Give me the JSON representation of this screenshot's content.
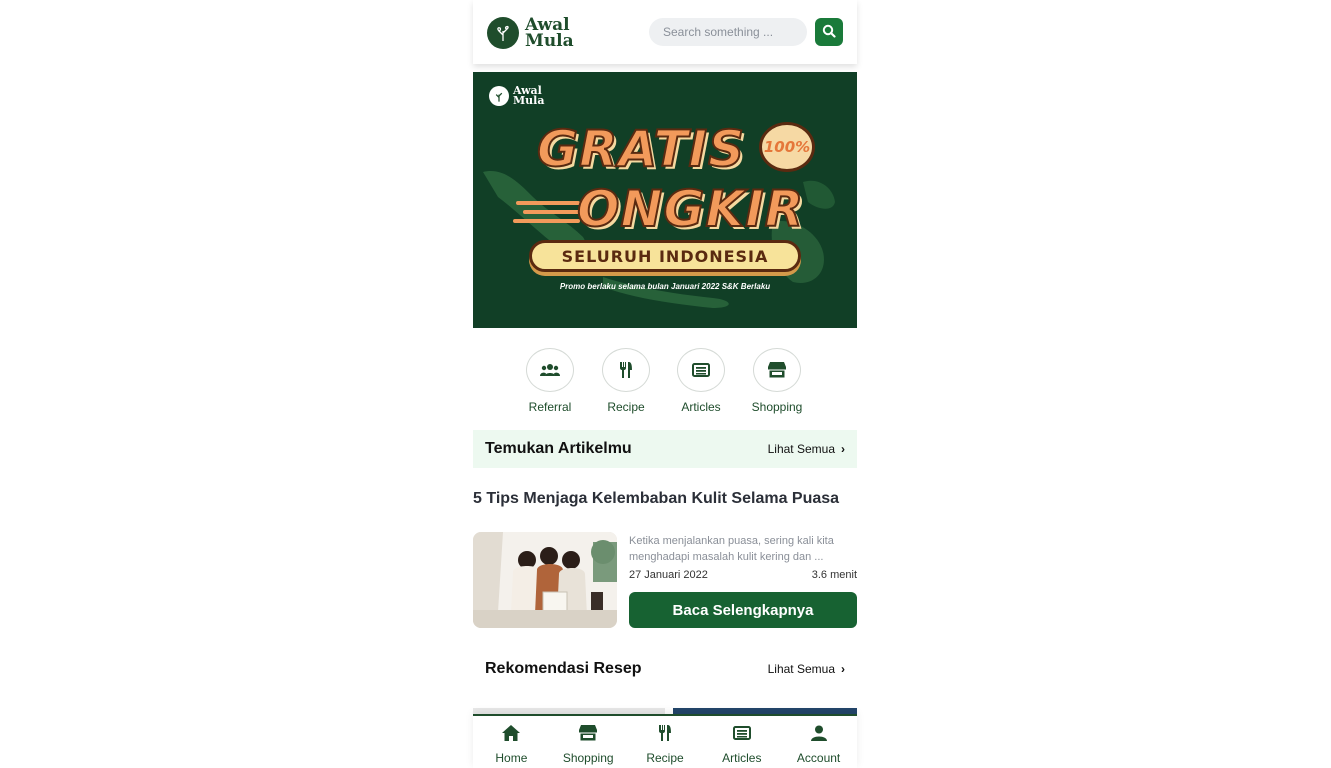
{
  "header": {
    "logo_line1": "Awal",
    "logo_line2": "Mula",
    "search_placeholder": "Search something ..."
  },
  "banner": {
    "logo_line1": "Awal",
    "logo_line2": "Mula",
    "headline1": "GRATIS",
    "badge": "100%",
    "headline2": "ONGKIR",
    "pill": "SELURUH INDONESIA",
    "promo": "Promo berlaku selama bulan Januari 2022 S&K Berlaku"
  },
  "quick_menu": [
    {
      "label": "Referral",
      "icon": "users-icon"
    },
    {
      "label": "Recipe",
      "icon": "utensils-icon"
    },
    {
      "label": "Articles",
      "icon": "newspaper-icon"
    },
    {
      "label": "Shopping",
      "icon": "store-icon"
    }
  ],
  "articles_section": {
    "title": "Temukan Artikelmu",
    "see_all": "Lihat Semua"
  },
  "article": {
    "title": "5 Tips Menjaga Kelembaban Kulit Selama Puasa",
    "excerpt": "Ketika menjalankan puasa, sering kali kita menghadapi masalah kulit kering dan ...",
    "date": "27 Januari 2022",
    "read_time": "3.6 menit",
    "button": "Baca Selengkapnya"
  },
  "recipe_section": {
    "title": "Rekomendasi Resep",
    "see_all": "Lihat Semua"
  },
  "bottom_nav": [
    {
      "label": "Home",
      "icon": "home-icon"
    },
    {
      "label": "Shopping",
      "icon": "store-icon"
    },
    {
      "label": "Recipe",
      "icon": "utensils-icon"
    },
    {
      "label": "Articles",
      "icon": "newspaper-icon"
    },
    {
      "label": "Account",
      "icon": "user-icon"
    }
  ],
  "colors": {
    "brand_green": "#1f4d2c",
    "button_green": "#176232",
    "banner_bg": "#113f26",
    "section_bg": "#edf9f0"
  }
}
